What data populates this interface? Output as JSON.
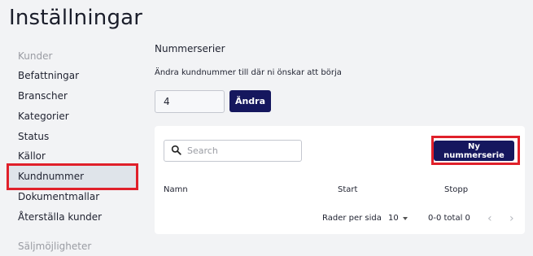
{
  "page": {
    "title": "Inställningar"
  },
  "sidebar": {
    "section_customers": "Kunder",
    "items": [
      {
        "label": "Befattningar"
      },
      {
        "label": "Branscher"
      },
      {
        "label": "Kategorier"
      },
      {
        "label": "Status"
      },
      {
        "label": "Källor"
      },
      {
        "label": "Kundnummer",
        "active": true
      },
      {
        "label": "Dokumentmallar"
      },
      {
        "label": "Återställa kunder"
      }
    ],
    "section_opportunities": "Säljmöjligheter"
  },
  "main": {
    "section_title": "Nummerserier",
    "description": "Ändra kundnummer till där ni önskar att börja",
    "number_input": {
      "value": "4"
    },
    "apply_button": "Ändra",
    "search": {
      "placeholder": "Search",
      "icon": "search-icon"
    },
    "new_series_button": "Ny nummerserie",
    "table": {
      "columns": [
        "Namn",
        "Start",
        "Stopp"
      ],
      "rows": []
    },
    "pagination": {
      "rows_per_page_label": "Rader per sida",
      "rows_per_page_value": "10",
      "range_text": "0-0 total 0"
    }
  },
  "colors": {
    "primary": "#15175e",
    "highlight": "#e0202a",
    "active_item_bg": "#dfe4ea",
    "page_bg": "#f2f3f5"
  }
}
